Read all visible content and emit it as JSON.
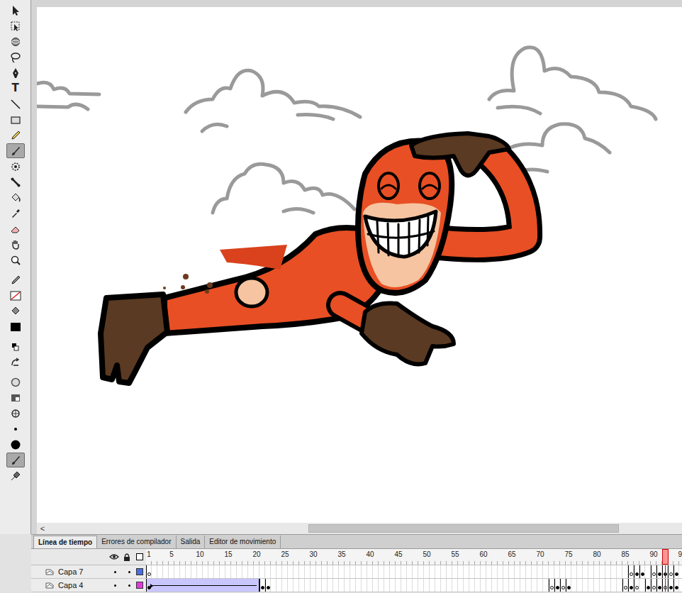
{
  "tools": [
    {
      "kind": "selection",
      "selected": false
    },
    {
      "kind": "free-transform",
      "selected": false
    },
    {
      "kind": "rotate-3d",
      "selected": false
    },
    {
      "kind": "lasso",
      "selected": false
    },
    {
      "kind": "pen",
      "selected": false
    },
    {
      "kind": "text",
      "label": "T",
      "selected": false
    },
    {
      "kind": "line",
      "selected": false
    },
    {
      "kind": "rectangle",
      "selected": false
    },
    {
      "kind": "pencil",
      "selected": false
    },
    {
      "kind": "brush",
      "selected": true
    },
    {
      "kind": "deco",
      "selected": false
    },
    {
      "kind": "bone",
      "selected": false
    },
    {
      "kind": "bucket",
      "selected": false
    },
    {
      "kind": "eyedropper",
      "selected": false
    },
    {
      "kind": "eraser",
      "selected": false
    },
    {
      "kind": "hand",
      "selected": false
    },
    {
      "kind": "zoom",
      "selected": false
    },
    {
      "kind": "stroke-pencil",
      "selected": false
    },
    {
      "kind": "stroke-swatch",
      "selected": false
    },
    {
      "kind": "fill-bucket",
      "selected": false
    },
    {
      "kind": "fill-swatch",
      "selected": false
    },
    {
      "kind": "default-colors",
      "selected": false
    },
    {
      "kind": "swap-colors",
      "selected": false
    },
    {
      "kind": "object-drawing",
      "selected": false
    },
    {
      "kind": "lock-fill",
      "selected": false
    },
    {
      "kind": "brush-size-ring",
      "selected": false
    },
    {
      "kind": "small-dot",
      "selected": false
    },
    {
      "kind": "big-dot",
      "selected": false
    },
    {
      "kind": "brush-mode",
      "selected": true
    },
    {
      "kind": "pressure",
      "selected": false
    }
  ],
  "stage": {
    "horizontal_scrollbar": {
      "arrow": "<",
      "position": 0.41,
      "size": 0.49
    }
  },
  "panel_tabs": [
    {
      "label": "Línea de tiempo",
      "selected": true
    },
    {
      "label": "Errores de compilador",
      "selected": false
    },
    {
      "label": "Salida",
      "selected": false
    },
    {
      "label": "Editor de movimiento",
      "selected": false
    }
  ],
  "timeline": {
    "ruler": [
      "1",
      "5",
      "10",
      "15",
      "20",
      "25",
      "30",
      "35",
      "40",
      "45",
      "50",
      "55",
      "60",
      "65",
      "70",
      "75",
      "80",
      "85",
      "90",
      "9"
    ],
    "current_frame": 92
  },
  "layers": [
    {
      "name": "Capa 7",
      "color": "#4a6ee0",
      "visible": true,
      "locked": false,
      "tweens": [],
      "keyframes": [
        {
          "frame": 1,
          "filled": false
        },
        {
          "frame": 86,
          "filled": false
        },
        {
          "frame": 87,
          "filled": true
        },
        {
          "frame": 88,
          "filled": true
        },
        {
          "frame": 90,
          "filled": false
        },
        {
          "frame": 91,
          "filled": true
        },
        {
          "frame": 92,
          "filled": true
        },
        {
          "frame": 93,
          "filled": false
        },
        {
          "frame": 94,
          "filled": true
        }
      ]
    },
    {
      "name": "Capa 4",
      "color": "#e03ce0",
      "visible": true,
      "locked": false,
      "tweens": [
        {
          "start": 1,
          "end": 20
        }
      ],
      "keyframes": [
        {
          "frame": 1,
          "filled": true
        },
        {
          "frame": 21,
          "filled": true
        },
        {
          "frame": 22,
          "filled": true
        },
        {
          "frame": 72,
          "filled": false
        },
        {
          "frame": 73,
          "filled": true
        },
        {
          "frame": 74,
          "filled": false
        },
        {
          "frame": 75,
          "filled": true
        },
        {
          "frame": 85,
          "filled": false
        },
        {
          "frame": 86,
          "filled": true
        },
        {
          "frame": 87,
          "filled": false
        },
        {
          "frame": 89,
          "filled": true
        },
        {
          "frame": 90,
          "filled": false
        },
        {
          "frame": 91,
          "filled": true
        },
        {
          "frame": 92,
          "filled": false
        },
        {
          "frame": 93,
          "filled": true
        },
        {
          "frame": 94,
          "filled": true
        }
      ]
    }
  ]
}
